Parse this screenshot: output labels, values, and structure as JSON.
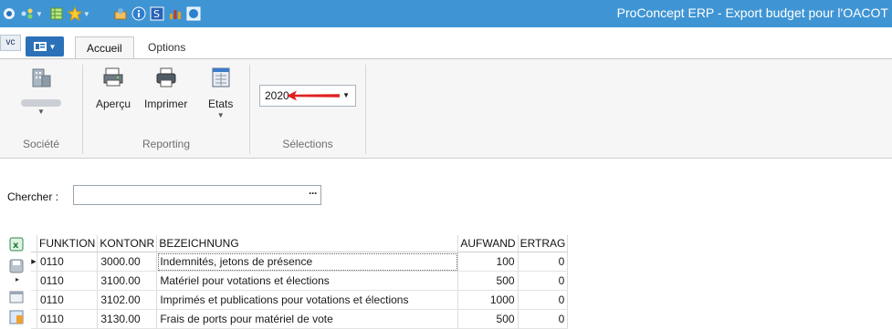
{
  "window": {
    "title": "ProConcept ERP - Export budget pour l'OACOT"
  },
  "quick_access": [
    "app-icon",
    "flow-icon",
    "grid-icon",
    "star-icon",
    "tools-icon",
    "info-icon",
    "s-icon",
    "chart-icon",
    "help-icon"
  ],
  "ribbon": {
    "vc_tag": "vc",
    "tabs": [
      {
        "label": "Accueil",
        "active": true
      },
      {
        "label": "Options",
        "active": false
      }
    ],
    "groups": {
      "societe": {
        "label": "Société",
        "button_label": ""
      },
      "reporting": {
        "label": "Reporting",
        "buttons": [
          {
            "label": "Aperçu"
          },
          {
            "label": "Imprimer"
          },
          {
            "label": "Etats"
          }
        ]
      },
      "selections": {
        "label": "Sélections",
        "year_value": "2020"
      }
    }
  },
  "search": {
    "label": "Chercher :",
    "value": "",
    "ellipsis": "···"
  },
  "table": {
    "columns": [
      "FUNKTION",
      "KONTONR",
      "BEZEICHNUNG",
      "AUFWAND",
      "ERTRAG"
    ],
    "rows": [
      {
        "funktion": "0110",
        "kontonr": "3000.00",
        "bezeichnung": "Indemnités, jetons de présence",
        "aufwand": "100",
        "ertrag": "0"
      },
      {
        "funktion": "0110",
        "kontonr": "3100.00",
        "bezeichnung": "Matériel pour votations et élections",
        "aufwand": "500",
        "ertrag": "0"
      },
      {
        "funktion": "0110",
        "kontonr": "3102.00",
        "bezeichnung": "Imprimés et publications pour votations et élections",
        "aufwand": "1000",
        "ertrag": "0"
      },
      {
        "funktion": "0110",
        "kontonr": "3130.00",
        "bezeichnung": "Frais de ports pour matériel de vote",
        "aufwand": "500",
        "ertrag": "0"
      }
    ]
  },
  "colors": {
    "titlebar": "#3f95d4",
    "accent_arrow": "#e02020",
    "ribbon_bg": "#f6f6f6"
  }
}
